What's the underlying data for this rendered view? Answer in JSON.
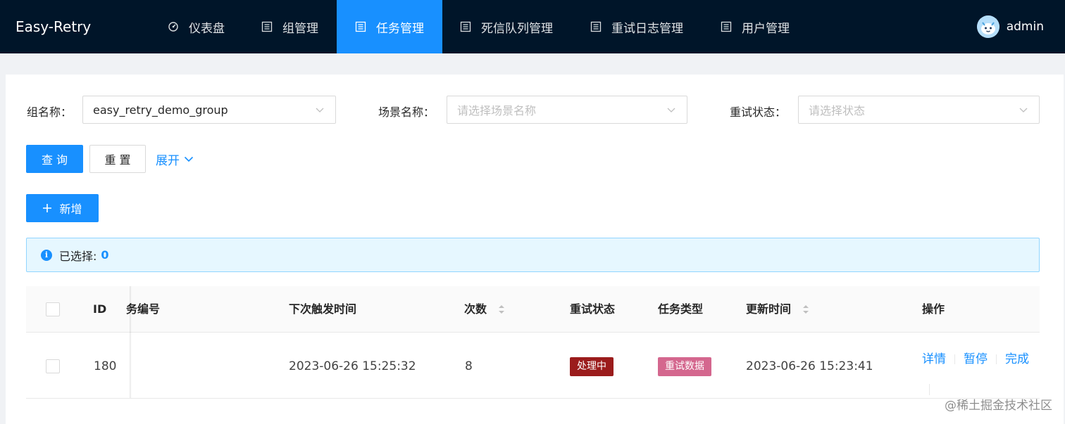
{
  "app": {
    "title": "Easy-Retry"
  },
  "nav": [
    {
      "label": "仪表盘",
      "icon": "dashboard-icon"
    },
    {
      "label": "组管理",
      "icon": "list-icon"
    },
    {
      "label": "任务管理",
      "icon": "list-icon",
      "active": true
    },
    {
      "label": "死信队列管理",
      "icon": "list-icon"
    },
    {
      "label": "重试日志管理",
      "icon": "list-icon"
    },
    {
      "label": "用户管理",
      "icon": "list-icon"
    }
  ],
  "user": {
    "name": "admin"
  },
  "filters": {
    "group": {
      "label": "组名称",
      "value": "easy_retry_demo_group"
    },
    "scene": {
      "label": "场景名称",
      "placeholder": "请选择场景名称"
    },
    "status": {
      "label": "重试状态",
      "placeholder": "请选择状态"
    }
  },
  "actions": {
    "query": "查 询",
    "reset": "重 置",
    "expand": "展开",
    "add": "新增"
  },
  "selection": {
    "label": "已选择:",
    "count": "0"
  },
  "table": {
    "columns": [
      "ID",
      "务编号",
      "下次触发时间",
      "次数",
      "重试状态",
      "任务类型",
      "更新时间",
      "操作"
    ],
    "rows": [
      {
        "id": "180",
        "next_trigger": "2023-06-26 15:25:32",
        "count": "8",
        "status": "处理中",
        "type": "重试数据",
        "updated": "2023-06-26 15:23:41",
        "ops": [
          "详情",
          "暂停",
          "完成"
        ]
      }
    ]
  },
  "colors": {
    "header_bg": "#001529",
    "primary": "#1890ff",
    "status_tag": "#9b1c1c",
    "type_tag": "#d4678e"
  },
  "watermark": "@稀土掘金技术社区"
}
